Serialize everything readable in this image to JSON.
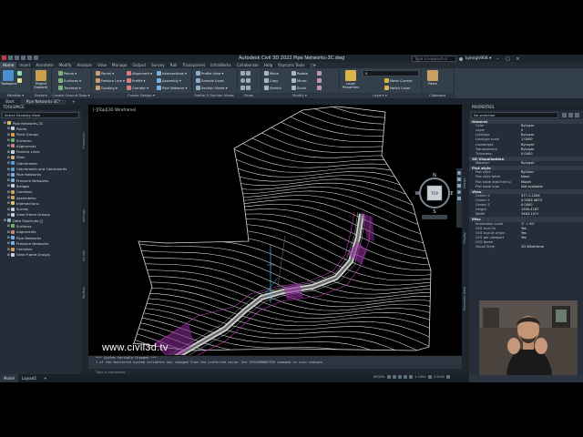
{
  "titlebar": {
    "title": "Autodesk Civil 3D 2022   Pipe Networks-3C.dwg",
    "search_placeholder": "Type a keyword or phrase",
    "user": "kyleigh908 ▾"
  },
  "ribbon_tabs": [
    "Home",
    "Insert",
    "Annotate",
    "Modify",
    "Analyze",
    "View",
    "Manage",
    "Output",
    "Survey",
    "Rail",
    "Transparent",
    "InfraWorks",
    "Collaborate",
    "Help",
    "Raycons Tools",
    "□▾"
  ],
  "ribbon": {
    "panels": [
      "Palettes ▾",
      "Explore",
      "Create Ground Data ▾",
      "Create Design ▾",
      "Profile & Section Views",
      "Draw",
      "Modify ▾",
      "Layers ▾",
      "Clipboard"
    ],
    "big_buttons": [
      "Toolspace",
      "Project Explorer",
      "Layer Properties",
      "Paste"
    ],
    "create_ground": [
      "Points ▾",
      "Surfaces ▾",
      "Traverse ▾"
    ],
    "create_design": [
      "Parcel ▾",
      "Feature Line ▾",
      "Grading ▾",
      "Alignment ▾",
      "Profile ▾",
      "Corridor ▾",
      "Intersections ▾",
      "Assembly ▾",
      "Pipe Network ▾"
    ],
    "profile_section": [
      "Profile View ▾",
      "Sample Lines",
      "Section Views ▾"
    ],
    "modify": [
      "Move",
      "Copy",
      "Stretch",
      "Rotate",
      "Mirror",
      "Scale"
    ],
    "layers": [
      "Make Current",
      "Match Layer"
    ],
    "layer_value": "0"
  },
  "doc_tabs": [
    "Start",
    "Pipe Networks-3C*"
  ],
  "toolspace": {
    "header": "TOOLSPACE",
    "dropdown": "Active Drawing View",
    "tree": [
      {
        "label": "Pipe Networks-3C",
        "color": "#e8c26a",
        "indent": 0
      },
      {
        "label": "Points",
        "color": "#c9d1da",
        "indent": 2
      },
      {
        "label": "Point Groups",
        "color": "#e0a040",
        "indent": 2
      },
      {
        "label": "Surfaces",
        "color": "#6fb06f",
        "indent": 2
      },
      {
        "label": "Alignments",
        "color": "#d08080",
        "indent": 2
      },
      {
        "label": "Feature Lines",
        "color": "#c9d1da",
        "indent": 2
      },
      {
        "label": "Sites",
        "color": "#d0b070",
        "indent": 2
      },
      {
        "label": "Catchments",
        "color": "#5aa0d0",
        "indent": 2
      },
      {
        "label": "Catchments and Catchments",
        "color": "#5aa0d0",
        "indent": 2
      },
      {
        "label": "Pipe Networks",
        "color": "#7ab0e0",
        "indent": 2
      },
      {
        "label": "Pressure Networks",
        "color": "#7ab0e0",
        "indent": 2
      },
      {
        "label": "Bridges",
        "color": "#c9d1da",
        "indent": 2
      },
      {
        "label": "Corridors",
        "color": "#d0a060",
        "indent": 2
      },
      {
        "label": "Assemblies",
        "color": "#d0a060",
        "indent": 2
      },
      {
        "label": "Intersections",
        "color": "#e0c070",
        "indent": 2
      },
      {
        "label": "Survey",
        "color": "#c9d1da",
        "indent": 2
      },
      {
        "label": "View Frame Groups",
        "color": "#c9d1da",
        "indent": 2
      },
      {
        "label": "Data Shortcuts []",
        "color": "#8fb0c8",
        "indent": 0
      },
      {
        "label": "Surfaces",
        "color": "#6fb06f",
        "indent": 2
      },
      {
        "label": "Alignments",
        "color": "#d08080",
        "indent": 2
      },
      {
        "label": "Pipe Networks",
        "color": "#7ab0e0",
        "indent": 2
      },
      {
        "label": "Pressure Networks",
        "color": "#7ab0e0",
        "indent": 2
      },
      {
        "label": "Corridors",
        "color": "#d0a060",
        "indent": 2
      },
      {
        "label": "View Frame Groups",
        "color": "#c9d1da",
        "indent": 2
      }
    ]
  },
  "side_tabs": [
    "Prospector",
    "Settings",
    "Survey",
    "Toolbox"
  ],
  "viewport": {
    "label": "[-][Top][2D Wireframe]",
    "viewcube": {
      "top": "TOP",
      "n": "N",
      "s": "S",
      "e": "E",
      "w": "W"
    },
    "watermark": "www.civil3d.tv"
  },
  "command": {
    "lines": [
      "*** System Variable Changed ***",
      "1 of the monitored system variables has changed from the preferred value. Use SYSVARMONITOR command to view changes."
    ],
    "prompt": "Type a command"
  },
  "layout_tabs": [
    "Model",
    "Layout1",
    "+"
  ],
  "status": {
    "model": "MODEL",
    "scale": "1:1000",
    "coord": "3.5000"
  },
  "properties": {
    "header": "PROPERTIES",
    "selection": "No selection",
    "groups": [
      {
        "name": "General",
        "rows": [
          [
            "Color",
            "ByLayer"
          ],
          [
            "Layer",
            "0"
          ],
          [
            "Linetype",
            "ByLayer"
          ],
          [
            "Linetype scale",
            "1.0000"
          ],
          [
            "Lineweight",
            "ByLayer"
          ],
          [
            "Transparency",
            "ByLayer"
          ],
          [
            "Thickness",
            "0.0000"
          ]
        ]
      },
      {
        "name": "3D Visualization",
        "rows": [
          [
            "Material",
            "ByLayer"
          ]
        ]
      },
      {
        "name": "Plot style",
        "rows": [
          [
            "Plot style",
            "ByColor"
          ],
          [
            "Plot style table",
            "None"
          ],
          [
            "Plot table attached to",
            "Model"
          ],
          [
            "Plot table type",
            "Not available"
          ]
        ]
      },
      {
        "name": "View",
        "rows": [
          [
            "Center X",
            "477.1.2206"
          ],
          [
            "Center Y",
            "4.9283.4879"
          ],
          [
            "Center Z",
            "0.0000"
          ],
          [
            "Height",
            "1900.4187"
          ],
          [
            "Width",
            "3463.1471"
          ]
        ]
      },
      {
        "name": "Misc",
        "rows": [
          [
            "Annotation scale",
            "1\" = 40'"
          ],
          [
            "UCS icon On",
            "Yes"
          ],
          [
            "UCS icon at origin",
            "Yes"
          ],
          [
            "UCS per viewport",
            "Yes"
          ],
          [
            "UCS Name",
            ""
          ],
          [
            "Visual Style",
            "2D Wireframe"
          ]
        ]
      }
    ],
    "side_tabs": [
      "Design",
      "Display",
      "Extended Data"
    ]
  }
}
